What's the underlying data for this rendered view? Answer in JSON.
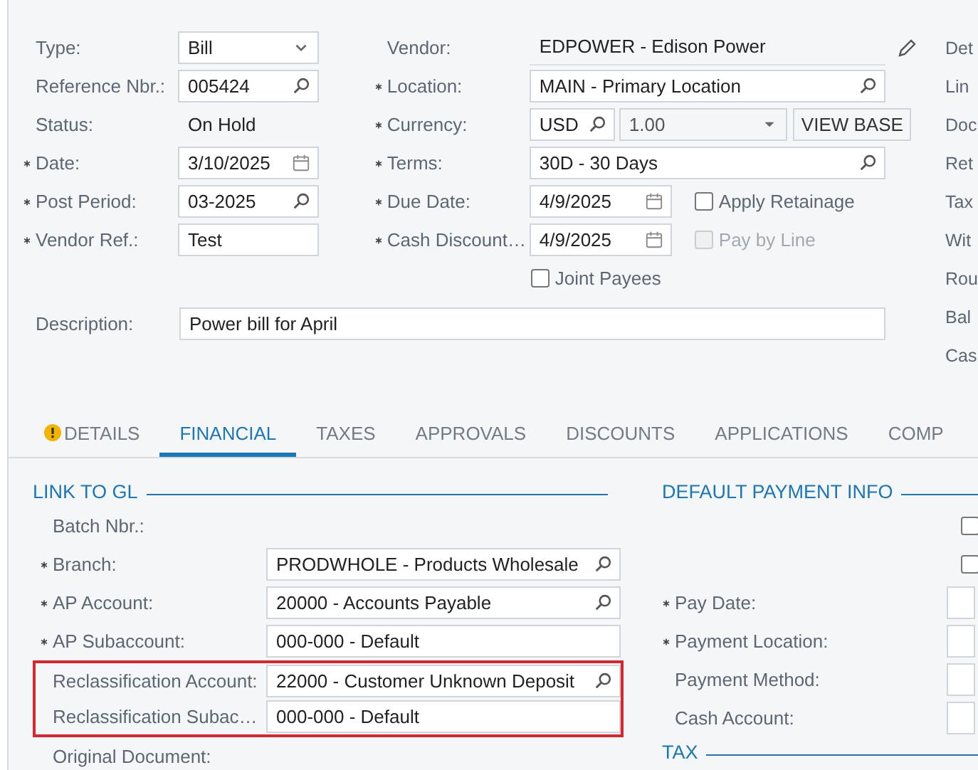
{
  "header": {
    "left_fields": [
      {
        "label": "Type:",
        "required": false,
        "kind": "select",
        "value": "Bill"
      },
      {
        "label": "Reference Nbr.:",
        "required": false,
        "kind": "lookup",
        "value": "005424"
      },
      {
        "label": "Status:",
        "required": false,
        "kind": "static",
        "value": "On Hold"
      },
      {
        "label": "Date:",
        "required": true,
        "kind": "date",
        "value": "3/10/2025"
      },
      {
        "label": "Post Period:",
        "required": true,
        "kind": "lookup",
        "value": "03-2025"
      },
      {
        "label": "Vendor Ref.:",
        "required": true,
        "kind": "text",
        "value": "Test"
      }
    ],
    "middle_fields": [
      {
        "label": "Vendor:",
        "required": false,
        "kind": "static",
        "value": "EDPOWER - Edison Power"
      },
      {
        "label": "Location:",
        "required": true,
        "kind": "lookup",
        "value": "MAIN - Primary Location"
      },
      {
        "label": "Currency:",
        "required": true,
        "kind": "currency",
        "value": "USD",
        "rate": "1.00",
        "button": "VIEW BASE"
      },
      {
        "label": "Terms:",
        "required": true,
        "kind": "lookup",
        "value": "30D - 30 Days"
      },
      {
        "label": "Due Date:",
        "required": true,
        "kind": "date",
        "value": "4/9/2025",
        "checkbox": {
          "label": "Apply Retainage",
          "checked": false,
          "disabled": false
        }
      },
      {
        "label": "Cash Discount…",
        "required": true,
        "kind": "date",
        "value": "4/9/2025",
        "checkbox": {
          "label": "Pay by Line",
          "checked": false,
          "disabled": true
        }
      },
      {
        "kind": "checkbox",
        "checkbox": {
          "label": "Joint Payees",
          "checked": false,
          "disabled": false
        }
      }
    ],
    "description": {
      "label": "Description:",
      "value": "Power bill for April"
    },
    "right_labels": [
      "Det",
      "Lin",
      "Doc",
      "Ret",
      "Tax",
      "Wit",
      "Rou",
      "Bal",
      "Cas"
    ]
  },
  "tabs": [
    {
      "label": "DETAILS",
      "selected": false,
      "warning": true
    },
    {
      "label": "FINANCIAL",
      "selected": true,
      "warning": false
    },
    {
      "label": "TAXES",
      "selected": false,
      "warning": false
    },
    {
      "label": "APPROVALS",
      "selected": false,
      "warning": false
    },
    {
      "label": "DISCOUNTS",
      "selected": false,
      "warning": false
    },
    {
      "label": "APPLICATIONS",
      "selected": false,
      "warning": false
    },
    {
      "label": "COMP",
      "selected": false,
      "warning": false
    }
  ],
  "link_to_gl": {
    "title": "LINK TO GL",
    "rows": [
      {
        "label": "Batch Nbr.:",
        "required": false,
        "kind": "static",
        "highlighted": false
      },
      {
        "label": "Branch:",
        "required": true,
        "kind": "lookup",
        "value": "PRODWHOLE - Products Wholesale",
        "highlighted": false
      },
      {
        "label": "AP Account:",
        "required": true,
        "kind": "lookup",
        "value": "20000 - Accounts Payable",
        "highlighted": false
      },
      {
        "label": "AP Subaccount:",
        "required": true,
        "kind": "text",
        "value": "000-000 - Default",
        "highlighted": false
      },
      {
        "label": "Reclassification Account:",
        "required": false,
        "kind": "lookup",
        "value": "22000 - Customer Unknown Deposit",
        "highlighted": true
      },
      {
        "label": "Reclassification Subac…",
        "required": false,
        "kind": "text",
        "value": "000-000 - Default",
        "highlighted": true
      },
      {
        "label": "Original Document:",
        "required": false,
        "kind": "static",
        "highlighted": false
      }
    ]
  },
  "default_payment_info": {
    "title": "DEFAULT PAYMENT INFO",
    "rows": [
      {
        "kind": "checkbox",
        "checked": false
      },
      {
        "kind": "checkbox",
        "checked": false
      },
      {
        "kind": "field",
        "label": "Pay Date:",
        "required": true
      },
      {
        "kind": "field",
        "label": "Payment Location:",
        "required": true
      },
      {
        "kind": "field",
        "label": "Payment Method:",
        "required": false
      },
      {
        "kind": "field",
        "label": "Cash Account:",
        "required": false
      }
    ]
  },
  "tax": {
    "title": "TAX"
  }
}
